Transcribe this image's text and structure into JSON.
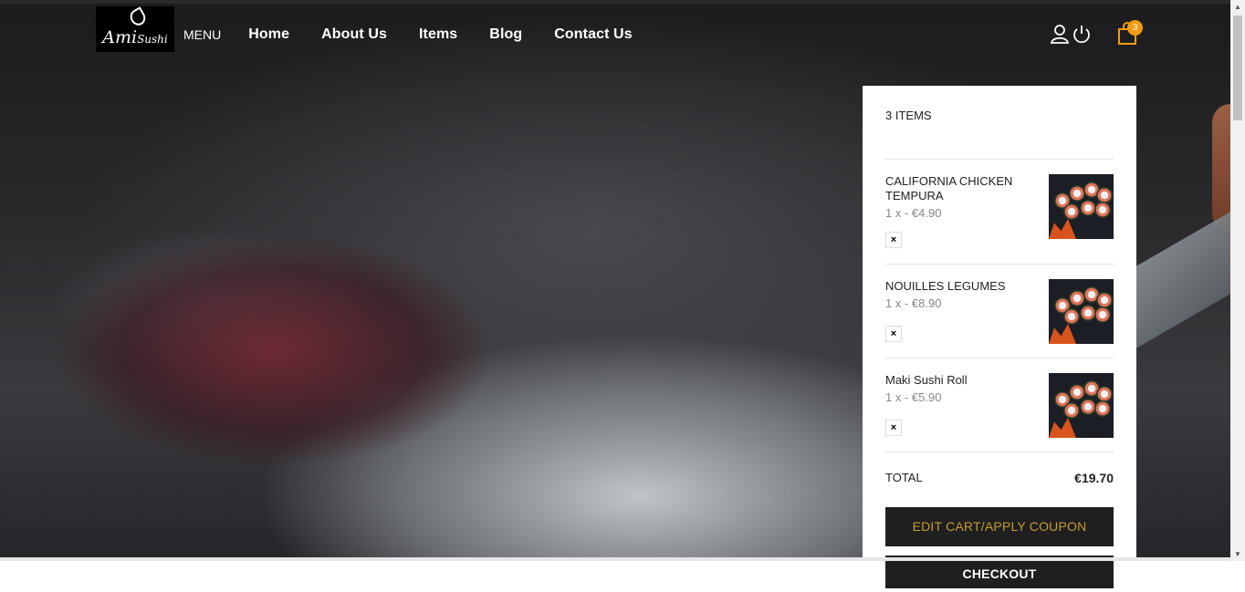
{
  "header": {
    "logo_text": "Ami",
    "logo_sub": "Sushi",
    "menu_label": "MENU",
    "nav": [
      "Home",
      "About Us",
      "Items",
      "Blog",
      "Contact Us"
    ],
    "cart_count": "3"
  },
  "cart": {
    "count_label": "3 ITEMS",
    "items": [
      {
        "name": "CALIFORNIA CHICKEN TEMPURA",
        "price": "1 x - €4.90",
        "remove": "×"
      },
      {
        "name": "NOUILLES LEGUMES",
        "price": "1 x - €8.90",
        "remove": "×"
      },
      {
        "name": "Maki Sushi Roll",
        "price": "1 x - €5.90",
        "remove": "×"
      }
    ],
    "total_label": "TOTAL",
    "total_value": "€19.70",
    "edit_button": "EDIT CART/APPLY COUPON",
    "checkout_button": "CHECKOUT"
  },
  "icons": [
    "user-icon",
    "power-icon",
    "shopping-bag-icon",
    "close-icon"
  ],
  "colors": {
    "accent": "#f39c12",
    "button_bg": "#1f1f1f",
    "edit_text": "#c79b2e"
  }
}
